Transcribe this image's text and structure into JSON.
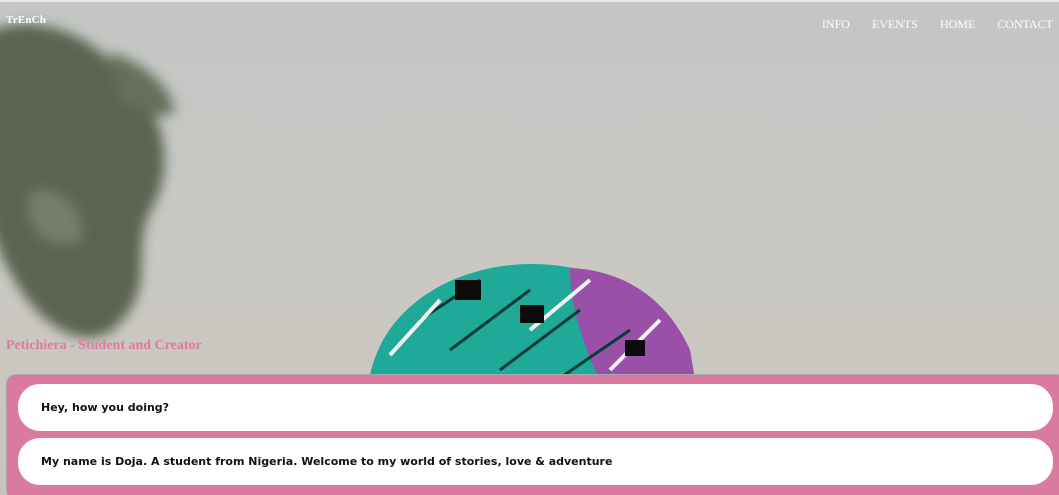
{
  "header": {
    "brand": "TrEnCh",
    "nav": [
      {
        "label": "INFO"
      },
      {
        "label": "EVENTS"
      },
      {
        "label": "HOME"
      },
      {
        "label": "CONTACT"
      }
    ]
  },
  "hero": {
    "subtitle": "Petichiera - Student and Creator"
  },
  "messages": [
    {
      "text": "Hey, how you doing?"
    },
    {
      "text": "My name is Doja. A student from Nigeria. Welcome to my world of stories, love & adventure"
    }
  ],
  "colors": {
    "accent_pink": "#db7aa0",
    "subtitle_pink": "#dd7aa3",
    "teal": "#1fa999",
    "purple": "#9a4fa8"
  }
}
